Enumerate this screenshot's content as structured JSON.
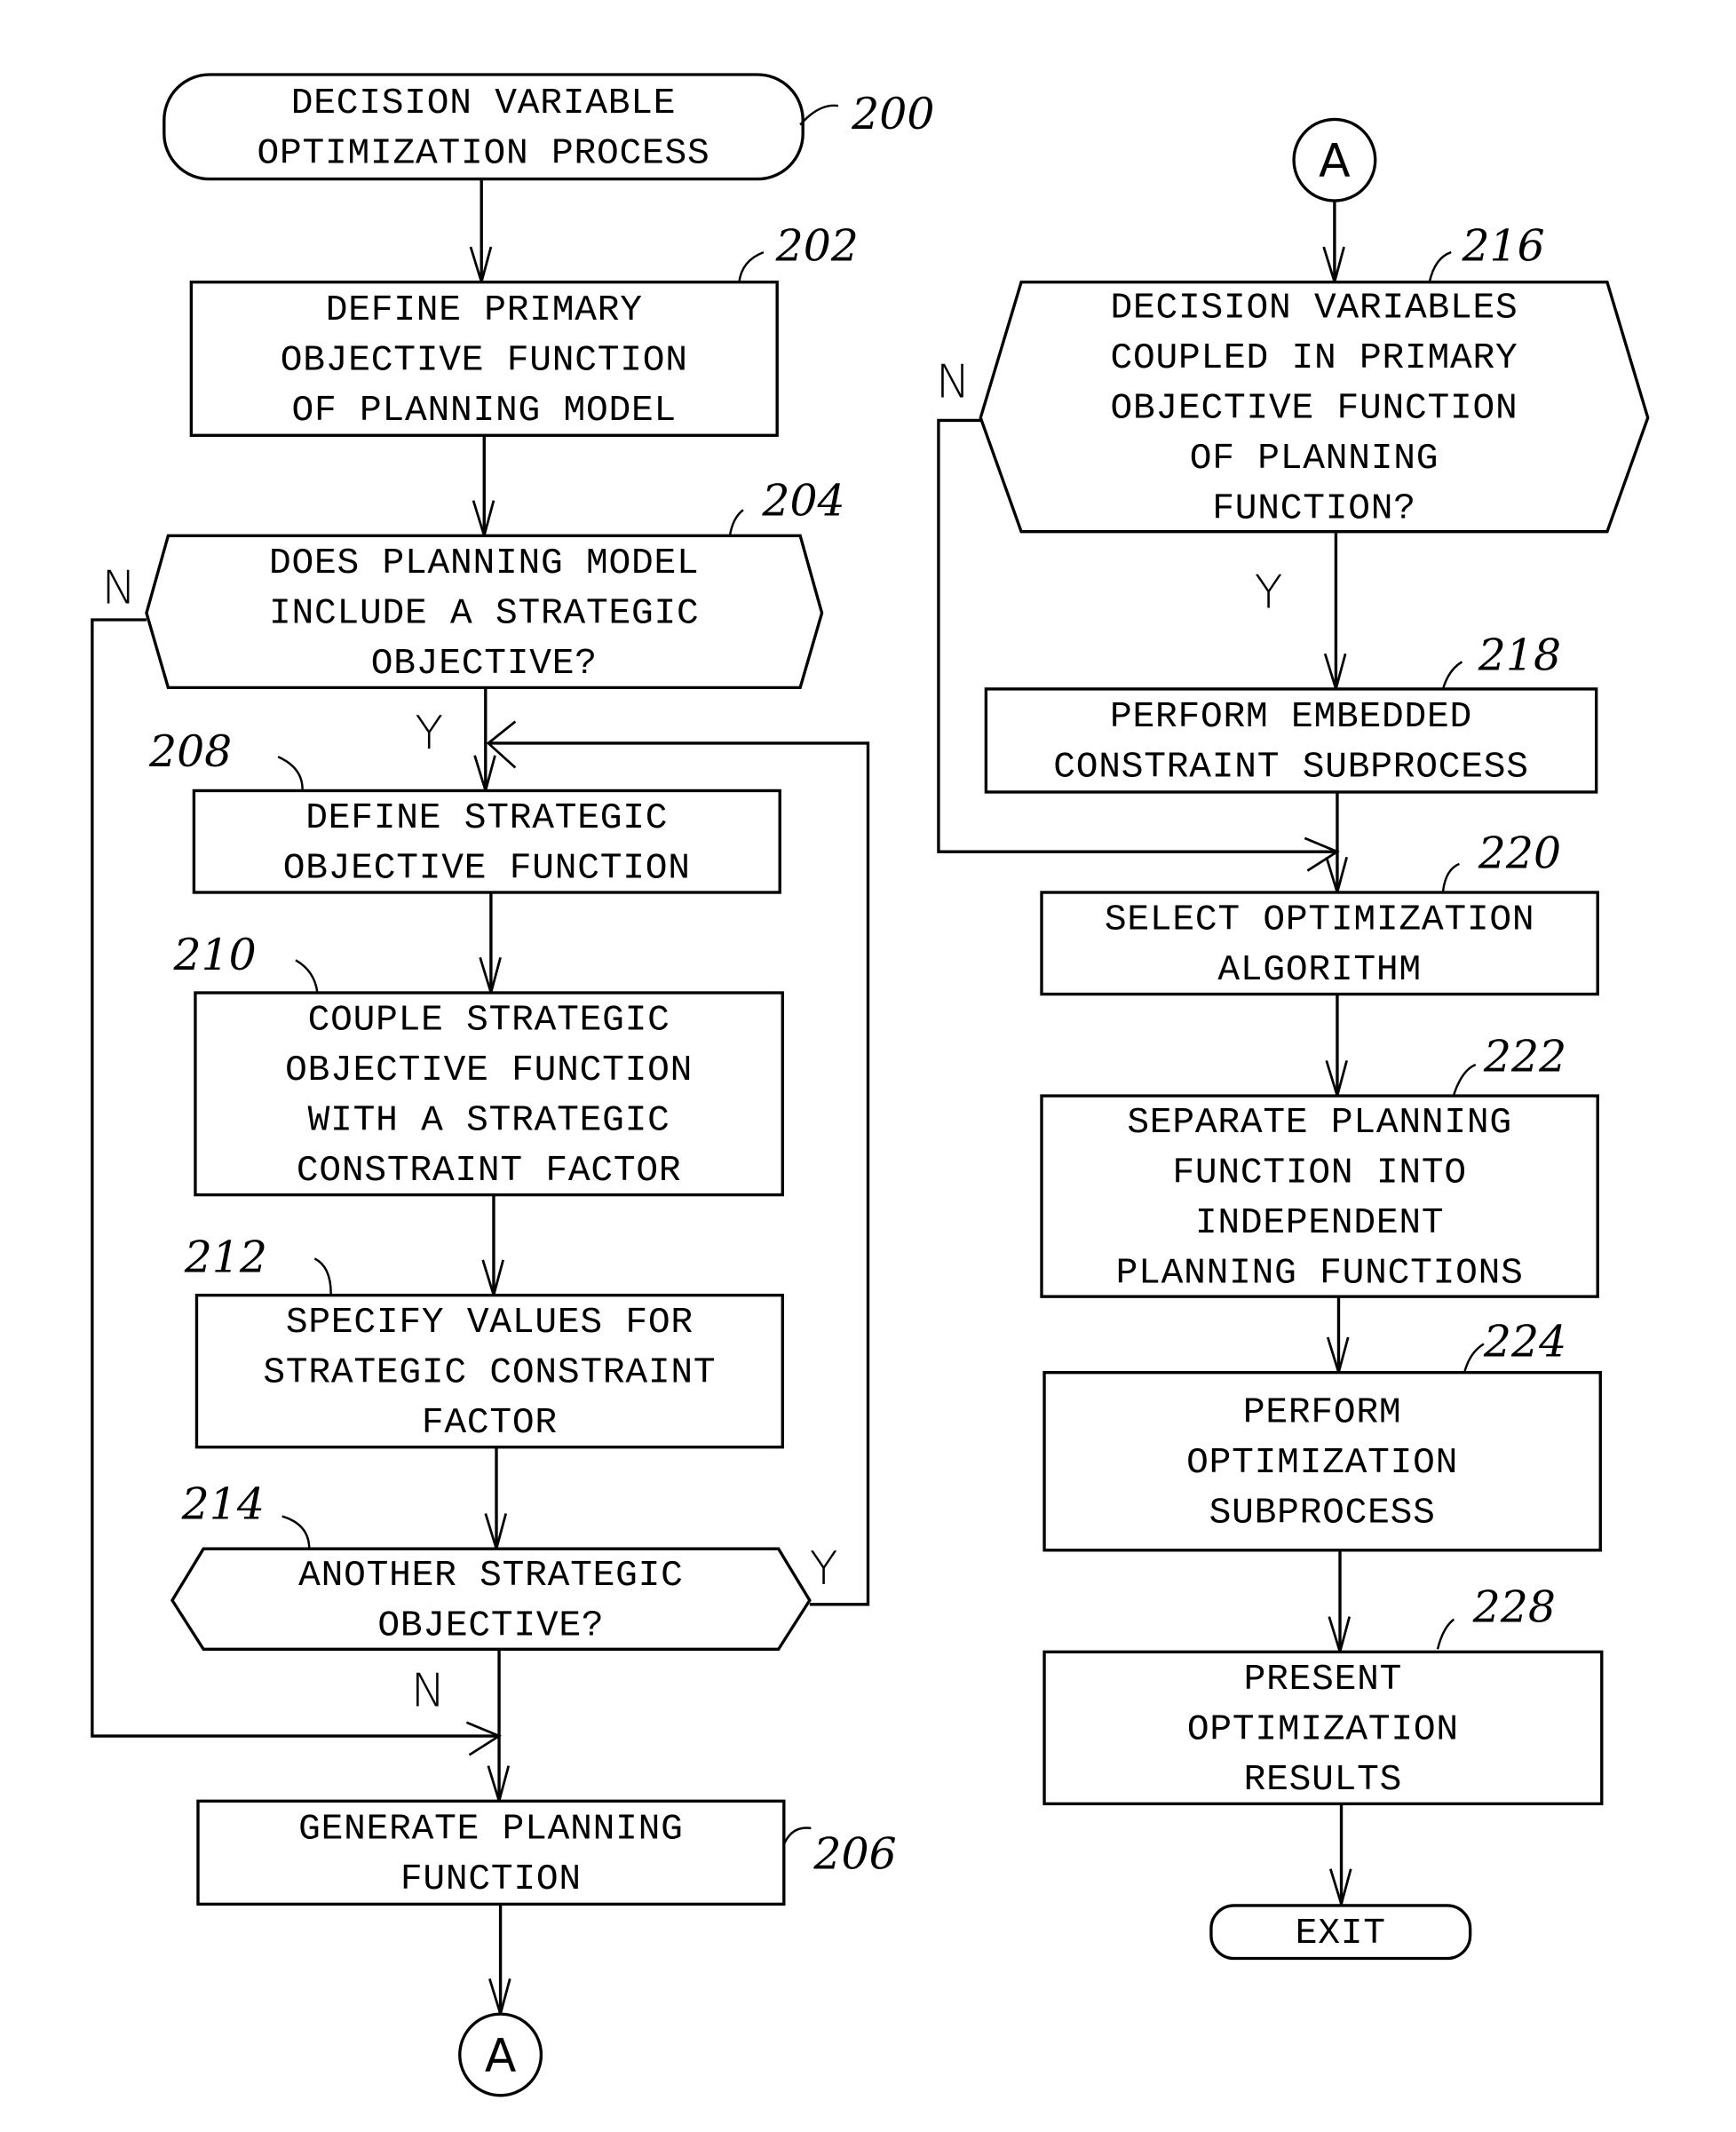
{
  "diagram": {
    "type": "flowchart",
    "connector_label": "A",
    "nodes": [
      {
        "id": "200",
        "kind": "terminal",
        "ref": "200",
        "lines": [
          "DECISION VARIABLE",
          "OPTIMIZATION PROCESS"
        ]
      },
      {
        "id": "202",
        "kind": "process",
        "ref": "202",
        "lines": [
          "DEFINE PRIMARY",
          "OBJECTIVE FUNCTION",
          "OF PLANNING MODEL"
        ]
      },
      {
        "id": "204",
        "kind": "decision",
        "ref": "204",
        "lines": [
          "DOES PLANNING MODEL",
          "INCLUDE A STRATEGIC",
          "OBJECTIVE?"
        ]
      },
      {
        "id": "208",
        "kind": "process",
        "ref": "208",
        "lines": [
          "DEFINE STRATEGIC",
          "OBJECTIVE FUNCTION"
        ]
      },
      {
        "id": "210",
        "kind": "process",
        "ref": "210",
        "lines": [
          "COUPLE STRATEGIC",
          "OBJECTIVE FUNCTION",
          "WITH A STRATEGIC",
          "CONSTRAINT FACTOR"
        ]
      },
      {
        "id": "212",
        "kind": "process",
        "ref": "212",
        "lines": [
          "SPECIFY VALUES FOR",
          "STRATEGIC CONSTRAINT",
          "FACTOR"
        ]
      },
      {
        "id": "214",
        "kind": "decision",
        "ref": "214",
        "lines": [
          "ANOTHER STRATEGIC",
          "OBJECTIVE?"
        ]
      },
      {
        "id": "206",
        "kind": "process",
        "ref": "206",
        "lines": [
          "GENERATE PLANNING",
          "FUNCTION"
        ]
      },
      {
        "id": "A1",
        "kind": "connector",
        "ref": "",
        "lines": [
          "A"
        ]
      },
      {
        "id": "A2",
        "kind": "connector",
        "ref": "",
        "lines": [
          "A"
        ]
      },
      {
        "id": "216",
        "kind": "decision",
        "ref": "216",
        "lines": [
          "DECISION VARIABLES",
          "COUPLED IN PRIMARY",
          "OBJECTIVE FUNCTION",
          "OF PLANNING",
          "FUNCTION?"
        ]
      },
      {
        "id": "218",
        "kind": "process",
        "ref": "218",
        "lines": [
          "PERFORM EMBEDDED",
          "CONSTRAINT SUBPROCESS"
        ]
      },
      {
        "id": "220",
        "kind": "process",
        "ref": "220",
        "lines": [
          "SELECT OPTIMIZATION",
          "ALGORITHM"
        ]
      },
      {
        "id": "222",
        "kind": "process",
        "ref": "222",
        "lines": [
          "SEPARATE PLANNING",
          "FUNCTION INTO",
          "INDEPENDENT",
          "PLANNING FUNCTIONS"
        ]
      },
      {
        "id": "224",
        "kind": "process",
        "ref": "224",
        "lines": [
          "PERFORM",
          "OPTIMIZATION",
          "SUBPROCESS"
        ]
      },
      {
        "id": "228",
        "kind": "process",
        "ref": "228",
        "lines": [
          "PRESENT",
          "OPTIMIZATION",
          "RESULTS"
        ]
      },
      {
        "id": "exit",
        "kind": "terminal",
        "ref": "",
        "lines": [
          "EXIT"
        ]
      }
    ],
    "edges": [
      {
        "from": "200",
        "to": "202",
        "label": ""
      },
      {
        "from": "202",
        "to": "204",
        "label": ""
      },
      {
        "from": "204",
        "to": "208",
        "label": "Y"
      },
      {
        "from": "204",
        "to": "206",
        "label": "N"
      },
      {
        "from": "208",
        "to": "210",
        "label": ""
      },
      {
        "from": "210",
        "to": "212",
        "label": ""
      },
      {
        "from": "212",
        "to": "214",
        "label": ""
      },
      {
        "from": "214",
        "to": "208",
        "label": "Y"
      },
      {
        "from": "214",
        "to": "206",
        "label": "N"
      },
      {
        "from": "206",
        "to": "A1",
        "label": ""
      },
      {
        "from": "A2",
        "to": "216",
        "label": ""
      },
      {
        "from": "216",
        "to": "218",
        "label": "Y"
      },
      {
        "from": "216",
        "to": "220",
        "label": "N"
      },
      {
        "from": "218",
        "to": "220",
        "label": ""
      },
      {
        "from": "220",
        "to": "222",
        "label": ""
      },
      {
        "from": "222",
        "to": "224",
        "label": ""
      },
      {
        "from": "224",
        "to": "228",
        "label": ""
      },
      {
        "from": "228",
        "to": "exit",
        "label": ""
      }
    ],
    "branch_labels": {
      "yes": "Y",
      "no": "N"
    }
  }
}
